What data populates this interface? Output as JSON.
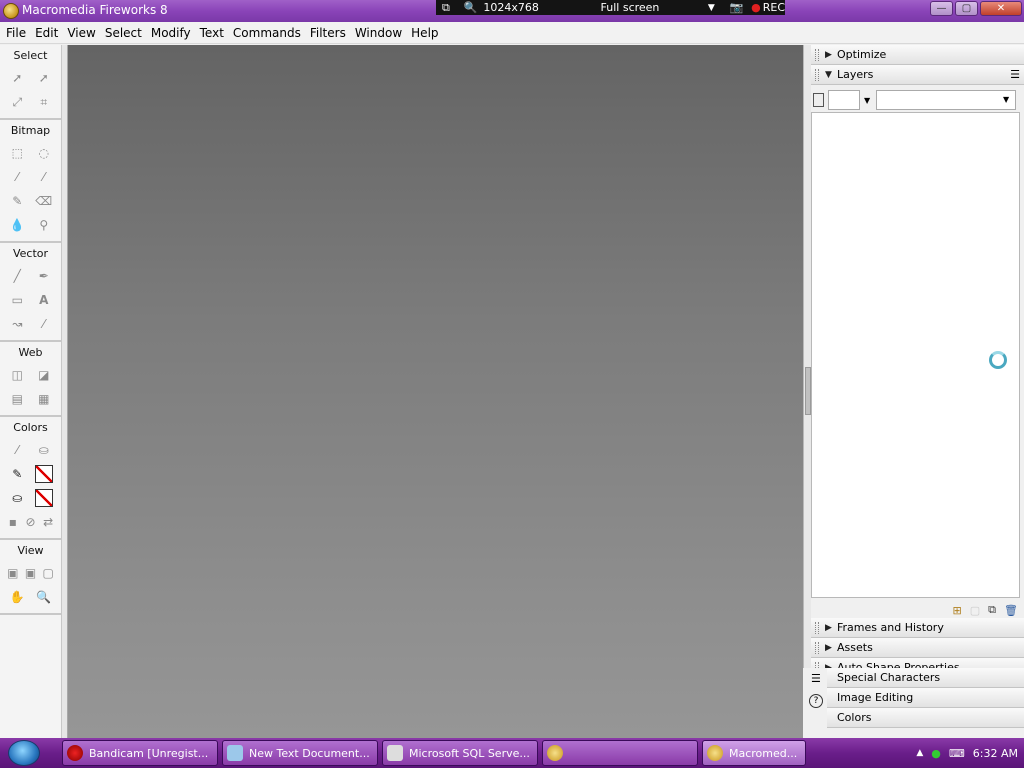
{
  "window": {
    "title": "Macromedia Fireworks 8",
    "buttons": {
      "minimize": "—",
      "maximize": "▢",
      "close": "✕"
    }
  },
  "bandicam": {
    "resolution": "1024x768",
    "mode": "Full screen",
    "rec": "REC"
  },
  "menubar": {
    "items": [
      "File",
      "Edit",
      "View",
      "Select",
      "Modify",
      "Text",
      "Commands",
      "Filters",
      "Window",
      "Help"
    ]
  },
  "tools": {
    "sections": [
      "Select",
      "Bitmap",
      "Vector",
      "Web",
      "Colors",
      "View"
    ]
  },
  "panels": {
    "optimize": "Optimize",
    "layers": "Layers",
    "frames_history": "Frames and History",
    "assets": "Assets",
    "auto_shape": "Auto Shape Properties",
    "special_chars": "Special Characters",
    "image_editing": "Image Editing",
    "colors": "Colors"
  },
  "taskbar": {
    "tasks": [
      "Bandicam [Unregist...",
      "New Text Document...",
      "Microsoft SQL Serve...",
      "",
      "Macromed..."
    ],
    "time": "6:32 AM"
  }
}
